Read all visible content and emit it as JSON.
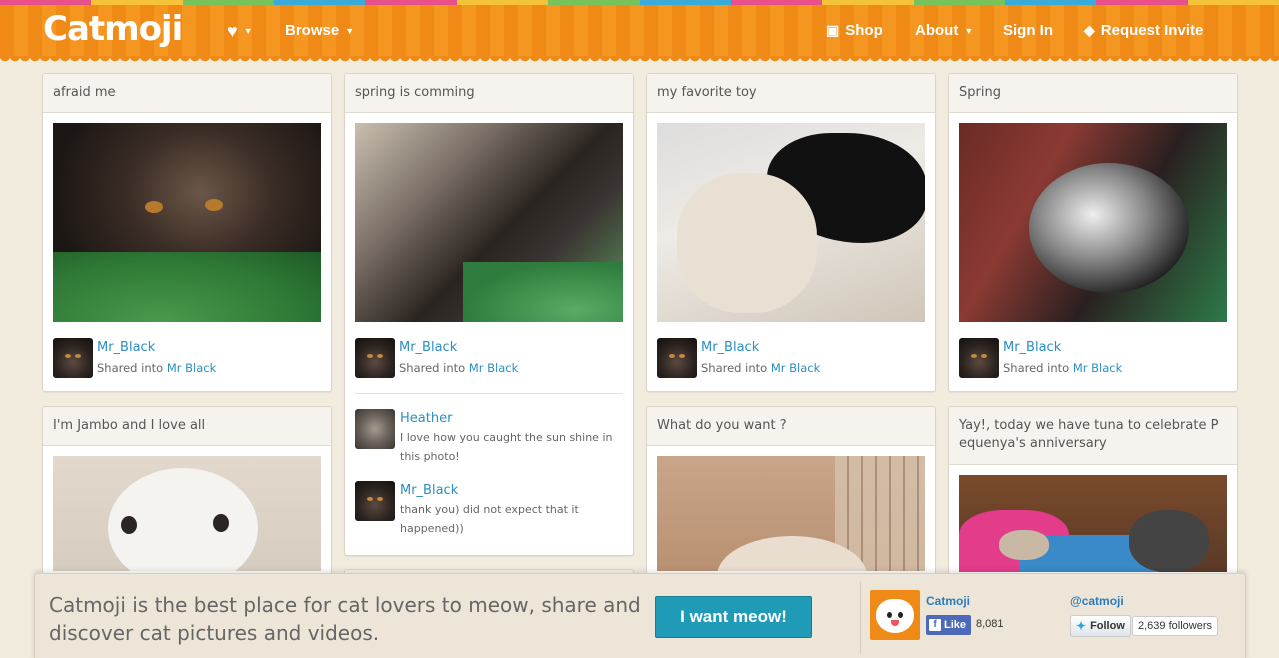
{
  "brand": {
    "logo": "Catmoji",
    "color": "#f08a16",
    "link_color": "#2b8fc0"
  },
  "rainbow_colors": [
    "#e8508a",
    "#f6c23a",
    "#77c35a",
    "#3aaad8",
    "#e8508a",
    "#f6c23a",
    "#77c35a",
    "#3aaad8",
    "#e8508a",
    "#f6c23a",
    "#77c35a",
    "#3aaad8",
    "#e8508a",
    "#f6c23a"
  ],
  "nav": {
    "favorites_icon": "heart-icon",
    "browse_label": "Browse",
    "shop_label": "Shop",
    "about_label": "About",
    "signin_label": "Sign In",
    "invite_label": "Request Invite"
  },
  "cards": [
    {
      "title": "afraid me",
      "owner": "Mr_Black",
      "shared_prefix": "Shared into",
      "board": "Mr Black"
    },
    {
      "title": "spring is comming",
      "owner": "Mr_Black",
      "shared_prefix": "Shared into",
      "board": "Mr Black",
      "comments": [
        {
          "author": "Heather",
          "text": "I love how you caught the sun shine in this photo!"
        },
        {
          "author": "Mr_Black",
          "text": "thank you) did not expect that it happened))"
        }
      ]
    },
    {
      "title": "my favorite toy",
      "owner": "Mr_Black",
      "shared_prefix": "Shared into",
      "board": "Mr Black"
    },
    {
      "title": "Spring",
      "owner": "Mr_Black",
      "shared_prefix": "Shared into",
      "board": "Mr Black"
    },
    {
      "title": "I'm Jambo and I love all"
    },
    {
      "title": "What do you want ?"
    },
    {
      "title": "Yay!, today we have tuna to celebrate P equenya's anniversary"
    }
  ],
  "banner": {
    "tagline": "Catmoji is the best place for cat lovers to meow, share and discover cat pictures and videos.",
    "cta": "I want meow!",
    "cta_color": "#1f9bb7",
    "fb_name": "Catmoji",
    "fb_like": "Like",
    "fb_count": "8,081",
    "tw_handle": "@catmoji",
    "tw_follow": "Follow",
    "tw_count": "2,639 followers"
  }
}
